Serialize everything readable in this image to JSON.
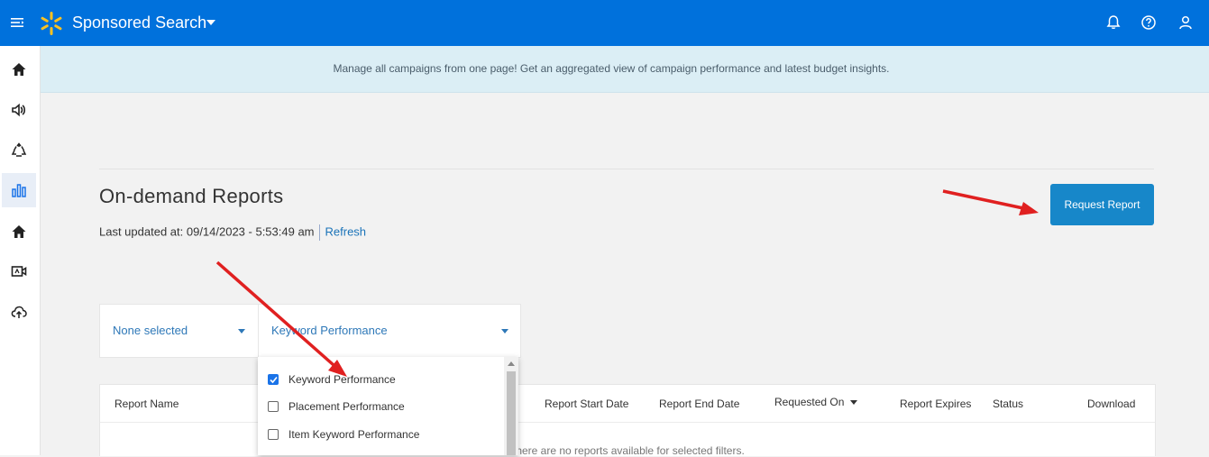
{
  "header": {
    "app_title": "Sponsored Search",
    "brand_color": "#0071dc"
  },
  "banner": {
    "text": "Manage all campaigns from one page! Get an aggregated view of campaign performance and latest budget insights.",
    "close": "×"
  },
  "page": {
    "title": "On-demand Reports",
    "last_updated_label": "Last updated at: 09/14/2023 - 5:53:49 am",
    "refresh_label": "Refresh",
    "request_button": "Request Report"
  },
  "filters": {
    "first_select": "None selected",
    "second_select": "Keyword Performance"
  },
  "dropdown_options": [
    {
      "label": "Keyword Performance",
      "checked": true
    },
    {
      "label": "Placement Performance",
      "checked": false
    },
    {
      "label": "Item Keyword Performance",
      "checked": false
    }
  ],
  "table": {
    "columns": [
      "Report Name",
      "Report Start Date",
      "Report End Date",
      "Requested On",
      "Report Expires",
      "Status",
      "Download"
    ],
    "empty_message": "There are no reports available for selected filters."
  },
  "annotation_color": "#e02020"
}
